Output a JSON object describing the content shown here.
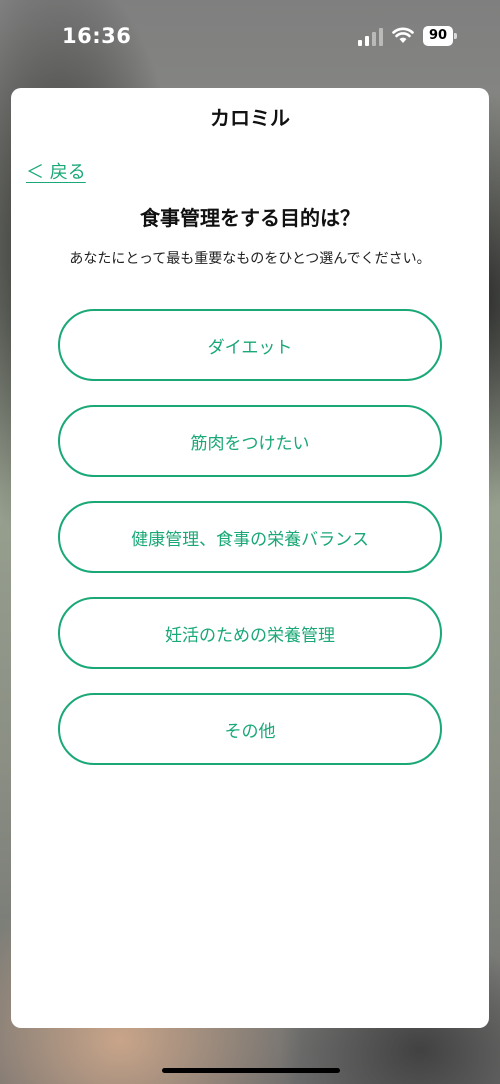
{
  "status_bar": {
    "time": "16:36",
    "battery": "90",
    "signal_icon": "cellular-signal-icon",
    "wifi_icon": "wifi-icon"
  },
  "app": {
    "title": "カロミル"
  },
  "nav": {
    "back_label": "＜ 戻る"
  },
  "question": {
    "title": "食事管理をする目的は？",
    "subtitle": "あなたにとって最も重要なものをひとつ選んでください。"
  },
  "options": [
    {
      "label": "ダイエット"
    },
    {
      "label": "筋肉をつけたい"
    },
    {
      "label": "健康管理、食事の栄養バランス"
    },
    {
      "label": "妊活のための栄養管理"
    },
    {
      "label": "その他"
    }
  ],
  "colors": {
    "accent": "#1aa876",
    "text": "#111111",
    "sheet_background": "#ffffff"
  }
}
